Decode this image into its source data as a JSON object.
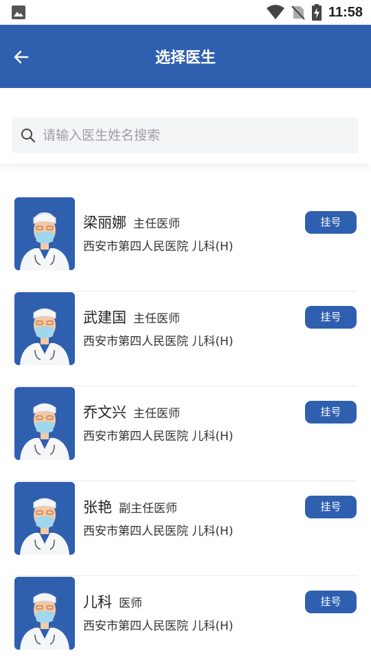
{
  "status_bar": {
    "time": "11:58",
    "icons": [
      "image-icon",
      "wifi-icon",
      "no-sim-icon",
      "battery-charging-icon"
    ]
  },
  "header": {
    "title": "选择医生",
    "back_icon": "arrow-left-icon"
  },
  "search": {
    "placeholder": "请输入医生姓名搜索",
    "value": "",
    "icon": "search-icon"
  },
  "doctors": [
    {
      "name": "梁丽娜",
      "title": "主任医师",
      "hospital": "西安市第四人民医院  儿科(H)",
      "button": "挂号"
    },
    {
      "name": "武建国",
      "title": "主任医师",
      "hospital": "西安市第四人民医院  儿科(H)",
      "button": "挂号"
    },
    {
      "name": "乔文兴",
      "title": "主任医师",
      "hospital": "西安市第四人民医院  儿科(H)",
      "button": "挂号"
    },
    {
      "name": "张艳",
      "title": "副主任医师",
      "hospital": "西安市第四人民医院  儿科(H)",
      "button": "挂号"
    },
    {
      "name": "儿科",
      "title": "医师",
      "hospital": "西安市第四人民医院  儿科(H)",
      "button": "挂号"
    }
  ],
  "colors": {
    "primary": "#2f5faf",
    "background": "#ffffff",
    "search_bg": "#f4f5f7"
  }
}
